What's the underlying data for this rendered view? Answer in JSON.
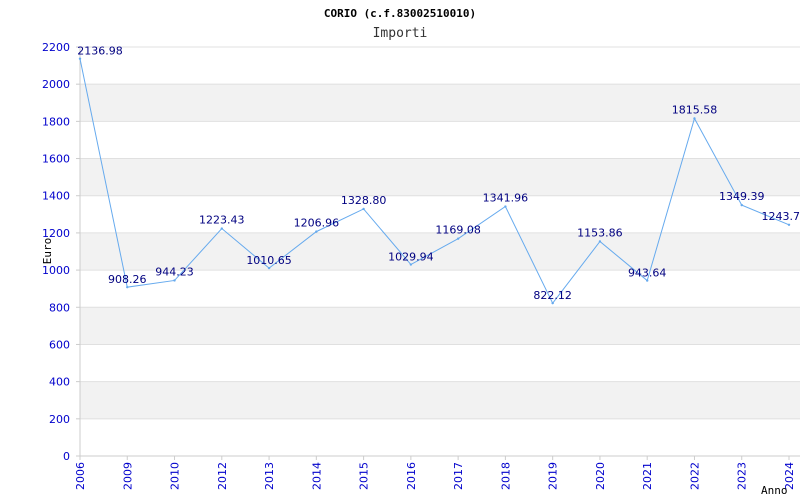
{
  "chart_data": {
    "type": "line",
    "title": "CORIO (c.f.83002510010)",
    "subtitle": "Importi",
    "xlabel": "Anno",
    "ylabel": "Euro",
    "ylim": [
      0,
      2200
    ],
    "yticks": [
      0,
      200,
      400,
      600,
      800,
      1000,
      1200,
      1400,
      1600,
      1800,
      2000,
      2200
    ],
    "grid": "alternating horizontal bands",
    "categories": [
      "2006",
      "2009",
      "2010",
      "2012",
      "2013",
      "2014",
      "2015",
      "2016",
      "2017",
      "2018",
      "2019",
      "2020",
      "2021",
      "2022",
      "2023",
      "2024"
    ],
    "series": [
      {
        "values": [
          2136.98,
          908.26,
          944.23,
          1223.43,
          1010.65,
          1206.96,
          1328.8,
          1029.94,
          1169.08,
          1341.96,
          822.12,
          1153.86,
          943.64,
          1815.58,
          1349.39,
          1243.7
        ]
      }
    ],
    "data_labels": [
      "2136.98",
      "908.26",
      "944.23",
      "1223.43",
      "1010.65",
      "1206.96",
      "1328.80",
      "1029.94",
      "1169.08",
      "1341.96",
      "822.12",
      "1153.86",
      "943.64",
      "1815.58",
      "1349.39",
      "1243.7"
    ],
    "colors": {
      "line": "#66aaee",
      "band": "#f2f2f2",
      "tick_text": "#0000cc",
      "label_text": "#000080"
    }
  }
}
